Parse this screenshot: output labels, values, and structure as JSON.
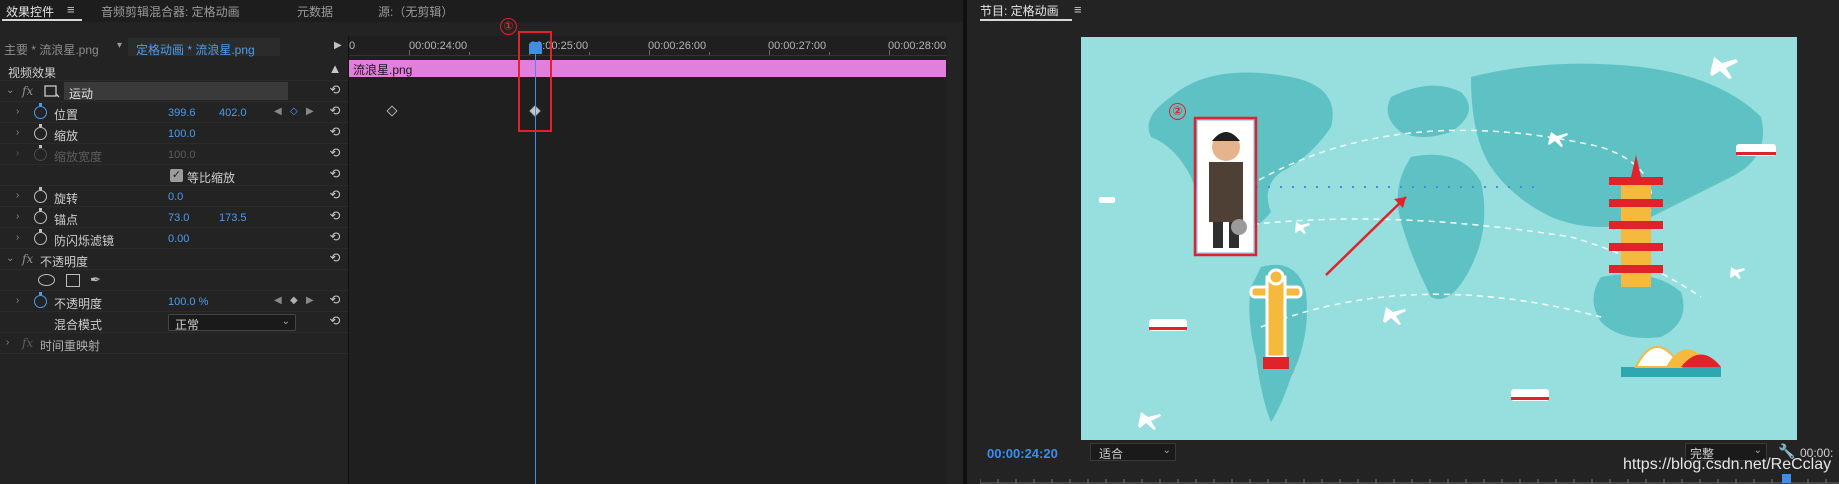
{
  "left_tabs": {
    "effect_controls": "效果控件",
    "audio_mixer": "音频剪辑混合器: 定格动画",
    "metadata": "元数据",
    "source": "源:（无剪辑）",
    "menu_glyph": "≡"
  },
  "clip_header": {
    "master": "主要 * 流浪星.png",
    "sequence": "定格动画 * 流浪星.png"
  },
  "video_effects_title": "视频效果",
  "effects": {
    "motion": "运动",
    "position": {
      "label": "位置",
      "x": "399.6",
      "y": "402.0"
    },
    "scale": {
      "label": "缩放",
      "value": "100.0"
    },
    "scale_width": {
      "label": "缩放宽度",
      "value": "100.0"
    },
    "uniform_scale": {
      "label": "等比缩放",
      "checked": true
    },
    "rotation": {
      "label": "旋转",
      "value": "0.0"
    },
    "anchor": {
      "label": "锚点",
      "x": "73.0",
      "y": "173.5"
    },
    "anti_flicker": {
      "label": "防闪烁滤镜",
      "value": "0.00"
    },
    "opacity_group": "不透明度",
    "opacity": {
      "label": "不透明度",
      "value": "100.0 %"
    },
    "blend_mode": {
      "label": "混合模式",
      "value": "正常"
    },
    "time_remap": "时间重映射",
    "fx": "fx"
  },
  "timeline": {
    "ruler_labels": [
      "0",
      "00:00:24:00",
      "00:00:25:00",
      "00:00:26:00",
      "00:00:27:00",
      "00:00:28:00"
    ],
    "clip_name": "流浪星.png",
    "annotation_1": "①"
  },
  "program": {
    "title": "节目: 定格动画",
    "menu_glyph": "≡",
    "timecode": "00:00:24:20",
    "fit": "适合",
    "quality": "完整",
    "right_timecode": "00:00:",
    "annotation_2": "②"
  },
  "watermark": "https://blog.csdn.net/ReCclay",
  "colors": {
    "accent": "#3f8fe8",
    "clip": "#e27fdc",
    "annotation": "#e0232a",
    "map_bg": "#97dede",
    "map_land": "#5ec2c4"
  }
}
